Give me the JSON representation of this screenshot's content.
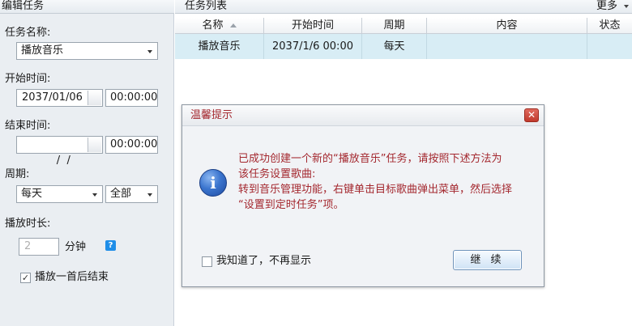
{
  "edit_panel": {
    "title": "编辑任务",
    "task_name_label": "任务名称:",
    "task_name_value": "播放音乐",
    "start_time_label": "开始时间:",
    "start_date_value": "2037/01/06",
    "start_time_value": "00:00:00",
    "end_time_label": "结束时间:",
    "end_date_value": "  /  /",
    "end_time_value": "00:00:00",
    "period_label": "周期:",
    "period_value": "每天",
    "period_scope_value": "全部",
    "duration_label": "播放时长:",
    "duration_value": "2",
    "duration_unit": "分钟",
    "help_glyph": "?",
    "stop_after_one_label": "播放一首后结束",
    "stop_after_one_checked": "✓"
  },
  "task_list": {
    "title": "任务列表",
    "more_label": "更多",
    "columns": [
      "名称",
      "开始时间",
      "周期",
      "内容",
      "状态"
    ],
    "rows": [
      {
        "name": "播放音乐",
        "start": "2037/1/6 00:00",
        "period": "每天",
        "content": "",
        "status": ""
      }
    ]
  },
  "dialog": {
    "title": "温馨提示",
    "close_glyph": "✕",
    "icon": "info-icon",
    "icon_glyph": "i",
    "message_lines": [
      "已成功创建一个新的“播放音乐”任务，请按照下述方法为",
      "该任务设置歌曲:",
      "转到音乐管理功能，右键单击目标歌曲弹出菜单，然后选择",
      "“设置到定时任务”项。"
    ],
    "dont_show_label": "我知道了，不再显示",
    "continue_label": "继 续"
  },
  "colors": {
    "panel_bg": "#eaeef2",
    "selected_row": "#d8edf5",
    "dialog_text": "#a4282f",
    "help_icon": "#1f8ee8"
  }
}
